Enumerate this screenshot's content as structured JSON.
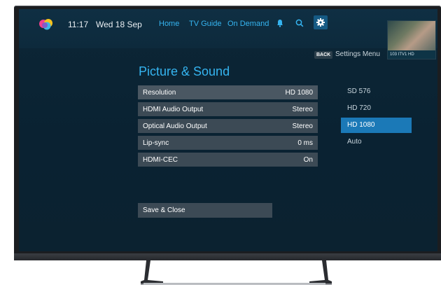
{
  "header": {
    "time": "11:17",
    "date": "Wed 18 Sep",
    "nav": [
      "Home",
      "TV Guide",
      "On Demand"
    ],
    "icons": [
      "bell-icon",
      "search-icon",
      "gear-icon"
    ],
    "thumbnail_label": "103 ITV1 HD"
  },
  "back": {
    "key": "BACK",
    "label": "Settings Menu"
  },
  "page": {
    "title": "Picture & Sound"
  },
  "settings": [
    {
      "label": "Resolution",
      "value": "HD 1080"
    },
    {
      "label": "HDMI Audio Output",
      "value": "Stereo"
    },
    {
      "label": "Optical Audio Output",
      "value": "Stereo"
    },
    {
      "label": "Lip-sync",
      "value": "0 ms"
    },
    {
      "label": "HDMI-CEC",
      "value": "On"
    }
  ],
  "resolution_options": [
    "SD 576",
    "HD 720",
    "HD 1080",
    "Auto"
  ],
  "selected_option": "HD 1080",
  "save_label": "Save & Close",
  "colors": {
    "accent": "#35b4f0",
    "selected_option_bg": "#1b79b7",
    "row_bg": "#3c4a55",
    "screen_bg": "#0b2434"
  }
}
